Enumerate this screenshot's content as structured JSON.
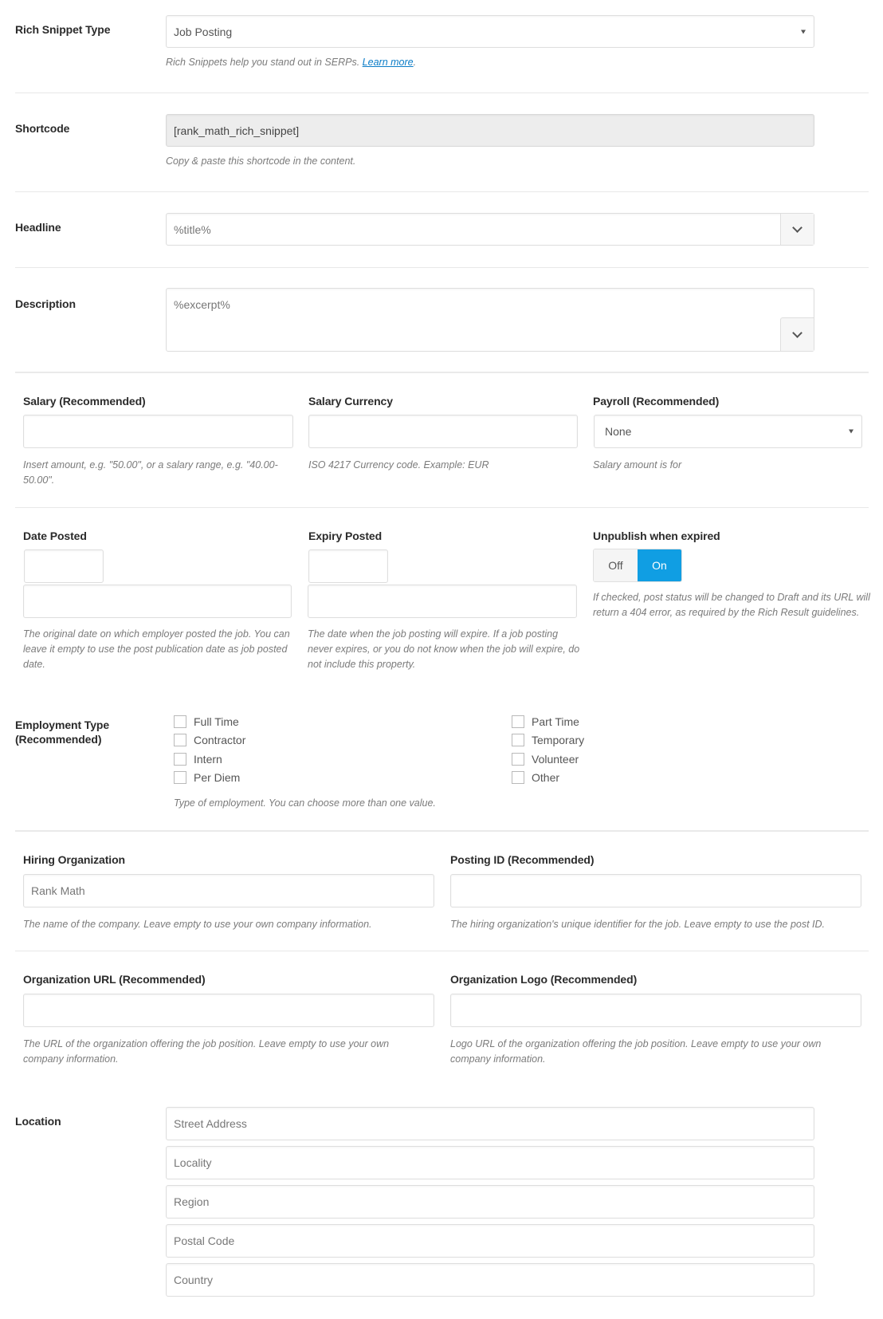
{
  "rich_snippet_type": {
    "label": "Rich Snippet Type",
    "selected": "Job Posting",
    "help_text": "Rich Snippets help you stand out in SERPs. ",
    "help_link": "Learn more",
    "help_suffix": "."
  },
  "shortcode": {
    "label": "Shortcode",
    "value": "[rank_math_rich_snippet]",
    "help": "Copy & paste this shortcode in the content."
  },
  "headline": {
    "label": "Headline",
    "value": "%title%"
  },
  "description": {
    "label": "Description",
    "value": "%excerpt%"
  },
  "salary": {
    "label": "Salary (Recommended)",
    "value": "",
    "help": "Insert amount, e.g. \"50.00\", or a salary range, e.g. \"40.00-50.00\"."
  },
  "salary_currency": {
    "label": "Salary Currency",
    "value": "",
    "help": "ISO 4217 Currency code. Example: EUR"
  },
  "payroll": {
    "label": "Payroll (Recommended)",
    "selected": "None",
    "help": "Salary amount is for"
  },
  "date_posted": {
    "label": "Date Posted",
    "date_value": "",
    "time_value": "",
    "help": "The original date on which employer posted the job. You can leave it empty to use the post publication date as job posted date."
  },
  "expiry_posted": {
    "label": "Expiry Posted",
    "date_value": "",
    "time_value": "",
    "help": "The date when the job posting will expire. If a job posting never expires, or you do not know when the job will expire, do not include this property."
  },
  "unpublish": {
    "label": "Unpublish when expired",
    "off_label": "Off",
    "on_label": "On",
    "state": "On",
    "accent_color": "#109ee3",
    "help": "If checked, post status will be changed to Draft and its URL will return a 404 error, as required by the Rich Result guidelines."
  },
  "employment_type": {
    "label_line1": "Employment Type",
    "label_line2": "(Recommended)",
    "options": [
      {
        "label": "Full Time",
        "checked": false
      },
      {
        "label": "Contractor",
        "checked": false
      },
      {
        "label": "Intern",
        "checked": false
      },
      {
        "label": "Per Diem",
        "checked": false
      },
      {
        "label": "Part Time",
        "checked": false
      },
      {
        "label": "Temporary",
        "checked": false
      },
      {
        "label": "Volunteer",
        "checked": false
      },
      {
        "label": "Other",
        "checked": false
      }
    ],
    "help": "Type of employment. You can choose more than one value."
  },
  "hiring_org": {
    "label": "Hiring Organization",
    "placeholder": "Rank Math",
    "help": "The name of the company. Leave empty to use your own company information."
  },
  "posting_id": {
    "label": "Posting ID (Recommended)",
    "value": "",
    "help": "The hiring organization's unique identifier for the job. Leave empty to use the post ID."
  },
  "org_url": {
    "label": "Organization URL (Recommended)",
    "value": "",
    "help": "The URL of the organization offering the job position. Leave empty to use your own company information."
  },
  "org_logo": {
    "label": "Organization Logo (Recommended)",
    "value": "",
    "help": "Logo URL of the organization offering the job position. Leave empty to use your own company information."
  },
  "location": {
    "label": "Location",
    "fields": [
      {
        "placeholder": "Street Address"
      },
      {
        "placeholder": "Locality"
      },
      {
        "placeholder": "Region"
      },
      {
        "placeholder": "Postal Code"
      },
      {
        "placeholder": "Country"
      }
    ]
  }
}
